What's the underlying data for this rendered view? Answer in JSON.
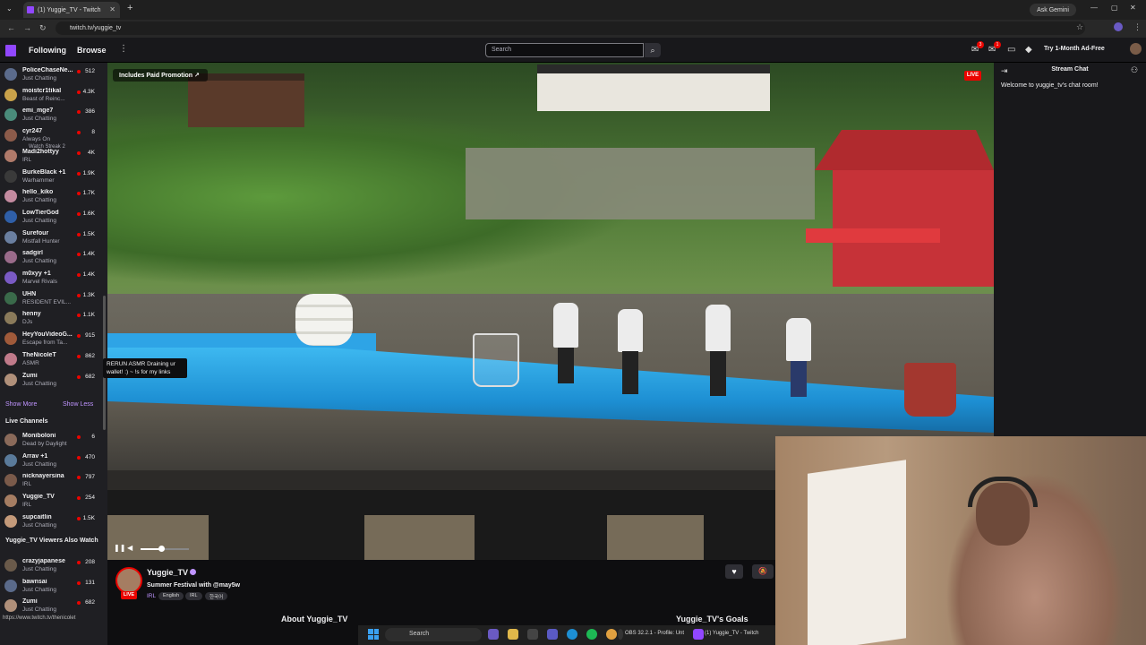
{
  "browser": {
    "tab_title": "(1) Yuggie_TV - Twitch",
    "url": "twitch.tv/yuggie_tv",
    "gemini_label": "Ask Gemini"
  },
  "topnav": {
    "following": "Following",
    "browse": "Browse",
    "search_placeholder": "Search",
    "notif_count_1": "3",
    "notif_count_2": "1",
    "adfree": "Try 1-Month Ad-Free"
  },
  "sidebar": {
    "followed": [
      {
        "name": "PoliceChaseNe...",
        "category": "Just Chatting",
        "viewers": "512",
        "color": "#5b6b8c"
      },
      {
        "name": "moistcr1tikal",
        "category": "Beast of Reinc...",
        "viewers": "4.3K",
        "color": "#c9a24a"
      },
      {
        "name": "emi_mge7",
        "category": "Just Chatting",
        "viewers": "386",
        "color": "#4a8c7b"
      },
      {
        "name": "cyr247",
        "category": "Always On",
        "viewers": "8",
        "color": "#8c5b4a"
      },
      {
        "name": "Madi2hottyy",
        "category": "IRL",
        "viewers": "4K",
        "color": "#b07a6a"
      },
      {
        "name": "BurkeBlack +1",
        "category": "Warhammer",
        "viewers": "1.9K",
        "color": "#3a3a3a"
      },
      {
        "name": "hello_kiko",
        "category": "Just Chatting",
        "viewers": "1.7K",
        "color": "#c48ba0"
      },
      {
        "name": "LowTierGod",
        "category": "Just Chatting",
        "viewers": "1.6K",
        "color": "#2f5fa8"
      },
      {
        "name": "Surefour",
        "category": "Mistfall Hunter",
        "viewers": "1.5K",
        "color": "#6a7fa0"
      },
      {
        "name": "sadgirl",
        "category": "Just Chatting",
        "viewers": "1.4K",
        "color": "#9a6b8a"
      },
      {
        "name": "m0xyy +1",
        "category": "Marvel Rivals",
        "viewers": "1.4K",
        "color": "#7a5ac4"
      },
      {
        "name": "UHN",
        "category": "RESIDENT EVIL...",
        "viewers": "1.3K",
        "color": "#3a6a4a"
      },
      {
        "name": "henny",
        "category": "DJs",
        "viewers": "1.1K",
        "color": "#8a7a5a"
      },
      {
        "name": "HeyYouVideoG...",
        "category": "Escape from Ta...",
        "viewers": "915",
        "color": "#a05a3a"
      },
      {
        "name": "TheNicoleT",
        "category": "ASMR",
        "viewers": "862",
        "color": "#c07a8a"
      },
      {
        "name": "Zumi",
        "category": "Just Chatting",
        "viewers": "682",
        "color": "#b0907a"
      }
    ],
    "watch_streak": "Watch Streak 2",
    "show_more": "Show More",
    "show_less": "Show Less",
    "live_channels_heading": "Live Channels",
    "live": [
      {
        "name": "Moniboloni",
        "category": "Dead by Daylight",
        "viewers": "6",
        "color": "#8a6a5a"
      },
      {
        "name": "Arrav +1",
        "category": "Just Chatting",
        "viewers": "470",
        "color": "#5a7a9a"
      },
      {
        "name": "nicknayersina",
        "category": "IRL",
        "viewers": "797",
        "color": "#7a5a4a"
      },
      {
        "name": "Yuggie_TV",
        "category": "IRL",
        "viewers": "254",
        "color": "#a57d62"
      },
      {
        "name": "supcaitlin",
        "category": "Just Chatting",
        "viewers": "1.5K",
        "color": "#c49a7a"
      }
    ],
    "also_watch_heading": "Yuggie_TV Viewers Also Watch",
    "also": [
      {
        "name": "crazyjapanese",
        "category": "Just Chatting",
        "viewers": "208",
        "color": "#6a5a4a"
      },
      {
        "name": "bawnsai",
        "category": "Just Chatting",
        "viewers": "131",
        "color": "#5a6a8a"
      },
      {
        "name": "Zumi",
        "category": "Just Chatting",
        "viewers": "682",
        "color": "#b0907a"
      }
    ],
    "tooltip": "RERUN ASMR Draining ur wallet! :) ~ !s for my links"
  },
  "player": {
    "promo": "Includes Paid Promotion",
    "live_badge": "LIVE"
  },
  "chat": {
    "header": "Stream Chat",
    "welcome": "Welcome to yuggie_tv's chat room!"
  },
  "channel": {
    "name": "Yuggie_TV",
    "live_badge": "LIVE",
    "title": "Summer Festival with @may5w",
    "category": "IRL",
    "tags": [
      "English",
      "IRL",
      "한국어"
    ],
    "about": "About Yuggie_TV",
    "goals": "Yuggie_TV's Goals"
  },
  "status_url": "https://www.twitch.tv/thenicolet",
  "taskbar": {
    "search": "Search",
    "obs": "OBS 32.2.1 - Profile: Unt",
    "twitch": "(1) Yuggie_TV - Twitch"
  }
}
